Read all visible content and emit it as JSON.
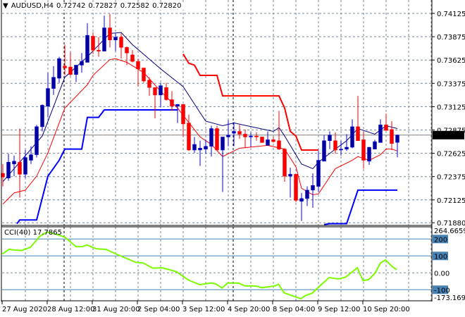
{
  "header": {
    "arrow_icon": "triangle-down-icon",
    "symbol": "AUDUSD,H4",
    "open": "0.72742",
    "high": "0.72827",
    "low": "0.72582",
    "close": "0.72820"
  },
  "price_axis": {
    "labels": [
      "0.74125",
      "0.73875",
      "0.73625",
      "0.73375",
      "0.73125",
      "0.72875",
      "0.72625",
      "0.72375",
      "0.72125",
      "0.71880"
    ],
    "current_price": "0.72820"
  },
  "time_axis": {
    "labels": [
      "27 Aug 2020",
      "28 Aug 12:00",
      "31 Aug 20:00",
      "2 Sep 04:00",
      "3 Sep 12:00",
      "4 Sep 20:00",
      "8 Sep 04:00",
      "9 Sep 12:00",
      "10 Sep 20:00"
    ]
  },
  "cci": {
    "name": "CCI(40)",
    "value": "17.7865",
    "axis_max": "264.6659",
    "axis_min": "-173.1699",
    "levels": [
      "200",
      "100",
      "0.00",
      "-100"
    ]
  },
  "colors": {
    "bull": "#0000a0",
    "bear": "#ff0000",
    "upper_band": "#000080",
    "lower_band": "#ff0000",
    "stop_upper": "#ff0000",
    "stop_lower": "#0000ff",
    "cci_line": "#7cfc00",
    "level": "#4682b4"
  },
  "chart_data": {
    "type": "candlestick",
    "title": "AUDUSD,H4",
    "ylim": [
      0.7188,
      0.74125
    ],
    "candles_ohlc": [
      [
        0.7241,
        0.7251,
        0.7227,
        0.7237
      ],
      [
        0.7236,
        0.7262,
        0.7233,
        0.7253
      ],
      [
        0.7251,
        0.726,
        0.7238,
        0.7254
      ],
      [
        0.7253,
        0.7289,
        0.7215,
        0.724
      ],
      [
        0.724,
        0.7266,
        0.7236,
        0.7258
      ],
      [
        0.7255,
        0.727,
        0.7251,
        0.7261
      ],
      [
        0.7261,
        0.7293,
        0.7258,
        0.7291
      ],
      [
        0.7291,
        0.7315,
        0.7286,
        0.7314
      ],
      [
        0.7313,
        0.7349,
        0.7301,
        0.7332
      ],
      [
        0.7332,
        0.7356,
        0.7325,
        0.7344
      ],
      [
        0.7343,
        0.7366,
        0.7338,
        0.7364
      ],
      [
        0.7356,
        0.7379,
        0.7346,
        0.7354
      ],
      [
        0.7355,
        0.7371,
        0.7345,
        0.7347
      ],
      [
        0.7347,
        0.7357,
        0.7339,
        0.7357
      ],
      [
        0.7357,
        0.737,
        0.7349,
        0.7361
      ],
      [
        0.736,
        0.7402,
        0.736,
        0.7389
      ],
      [
        0.7388,
        0.7392,
        0.7369,
        0.7373
      ],
      [
        0.7373,
        0.7387,
        0.7366,
        0.7372
      ],
      [
        0.7372,
        0.741,
        0.7372,
        0.7397
      ],
      [
        0.7397,
        0.7412,
        0.7376,
        0.7384
      ],
      [
        0.7384,
        0.7391,
        0.7372,
        0.7387
      ],
      [
        0.7387,
        0.7391,
        0.7364,
        0.7376
      ],
      [
        0.7376,
        0.7377,
        0.7357,
        0.737
      ],
      [
        0.7368,
        0.7373,
        0.736,
        0.7361
      ],
      [
        0.7361,
        0.7364,
        0.7334,
        0.7353
      ],
      [
        0.7354,
        0.7354,
        0.7338,
        0.734
      ],
      [
        0.7341,
        0.7344,
        0.7324,
        0.7333
      ],
      [
        0.7333,
        0.7333,
        0.73,
        0.7325
      ],
      [
        0.7325,
        0.7338,
        0.7312,
        0.7335
      ],
      [
        0.7333,
        0.7338,
        0.7319,
        0.732
      ],
      [
        0.732,
        0.7329,
        0.7308,
        0.7313
      ],
      [
        0.7313,
        0.7315,
        0.7295,
        0.7315
      ],
      [
        0.7315,
        0.7315,
        0.728,
        0.7294
      ],
      [
        0.7295,
        0.7304,
        0.7265,
        0.7266
      ],
      [
        0.7266,
        0.728,
        0.7263,
        0.7272
      ],
      [
        0.7266,
        0.7276,
        0.7249,
        0.7268
      ],
      [
        0.7267,
        0.7277,
        0.7262,
        0.727
      ],
      [
        0.727,
        0.7292,
        0.7259,
        0.7289
      ],
      [
        0.7289,
        0.7292,
        0.7265,
        0.7266
      ],
      [
        0.7266,
        0.728,
        0.7221,
        0.728
      ],
      [
        0.728,
        0.7298,
        0.727,
        0.7282
      ],
      [
        0.7284,
        0.7296,
        0.727,
        0.7286
      ],
      [
        0.7286,
        0.7293,
        0.7278,
        0.7283
      ],
      [
        0.7283,
        0.7288,
        0.7268,
        0.728
      ],
      [
        0.728,
        0.7285,
        0.7269,
        0.7281
      ],
      [
        0.7281,
        0.7285,
        0.7276,
        0.728
      ],
      [
        0.728,
        0.728,
        0.7274,
        0.7274
      ],
      [
        0.7271,
        0.7286,
        0.7271,
        0.7277
      ],
      [
        0.7277,
        0.728,
        0.7274,
        0.7275
      ],
      [
        0.7276,
        0.7308,
        0.7266,
        0.7267
      ],
      [
        0.7267,
        0.7268,
        0.7232,
        0.7238
      ],
      [
        0.7238,
        0.7247,
        0.7215,
        0.724
      ],
      [
        0.724,
        0.724,
        0.721,
        0.7212
      ],
      [
        0.7211,
        0.722,
        0.719,
        0.7214
      ],
      [
        0.7214,
        0.7227,
        0.7206,
        0.7223
      ],
      [
        0.7223,
        0.7241,
        0.7204,
        0.7228
      ],
      [
        0.7227,
        0.7265,
        0.7221,
        0.7255
      ],
      [
        0.7254,
        0.7282,
        0.7254,
        0.7276
      ],
      [
        0.7276,
        0.7286,
        0.7267,
        0.7282
      ],
      [
        0.7276,
        0.7285,
        0.7262,
        0.7266
      ],
      [
        0.7266,
        0.7276,
        0.726,
        0.7267
      ],
      [
        0.7267,
        0.7283,
        0.7265,
        0.7269
      ],
      [
        0.7269,
        0.7299,
        0.7268,
        0.7291
      ],
      [
        0.7291,
        0.7324,
        0.7276,
        0.7276
      ],
      [
        0.7277,
        0.7286,
        0.7246,
        0.7255
      ],
      [
        0.7254,
        0.7269,
        0.725,
        0.7269
      ],
      [
        0.7267,
        0.7277,
        0.7267,
        0.7275
      ],
      [
        0.7274,
        0.7299,
        0.7274,
        0.7293
      ],
      [
        0.7293,
        0.7305,
        0.7287,
        0.7287
      ],
      [
        0.7288,
        0.7297,
        0.7266,
        0.7273
      ],
      [
        0.72742,
        0.72827,
        0.72582,
        0.7282
      ]
    ],
    "upper_band": [
      [
        0,
        0.7232
      ],
      [
        4,
        0.726
      ],
      [
        7,
        0.7281
      ],
      [
        11,
        0.7344
      ],
      [
        15,
        0.7366
      ],
      [
        19,
        0.7391
      ],
      [
        21,
        0.7392
      ],
      [
        23,
        0.7379
      ],
      [
        28,
        0.7353
      ],
      [
        32,
        0.7334
      ],
      [
        35,
        0.7306
      ],
      [
        36,
        0.7297
      ],
      [
        39,
        0.7292
      ],
      [
        41,
        0.7295
      ],
      [
        48,
        0.7286
      ],
      [
        49,
        0.729
      ],
      [
        50,
        0.7281
      ],
      [
        53,
        0.7251
      ],
      [
        55,
        0.7246
      ],
      [
        56,
        0.7253
      ],
      [
        59,
        0.7267
      ],
      [
        61,
        0.7276
      ],
      [
        63,
        0.7289
      ],
      [
        65,
        0.7285
      ],
      [
        66,
        0.7283
      ],
      [
        68,
        0.7292
      ],
      [
        70,
        0.7289
      ]
    ],
    "lower_band": [
      [
        0,
        0.7208
      ],
      [
        2,
        0.722
      ],
      [
        4,
        0.7223
      ],
      [
        6,
        0.7238
      ],
      [
        8,
        0.7263
      ],
      [
        11,
        0.7311
      ],
      [
        15,
        0.7336
      ],
      [
        16,
        0.7346
      ],
      [
        19,
        0.7363
      ],
      [
        20,
        0.7364
      ],
      [
        22,
        0.736
      ],
      [
        25,
        0.7349
      ],
      [
        28,
        0.7329
      ],
      [
        31,
        0.7311
      ],
      [
        35,
        0.728
      ],
      [
        37,
        0.7272
      ],
      [
        39,
        0.7259
      ],
      [
        42,
        0.7268
      ],
      [
        47,
        0.7271
      ],
      [
        50,
        0.7267
      ],
      [
        52,
        0.7248
      ],
      [
        53,
        0.7225
      ],
      [
        55,
        0.7218
      ],
      [
        56,
        0.7219
      ],
      [
        59,
        0.7246
      ],
      [
        62,
        0.7255
      ],
      [
        63,
        0.7259
      ],
      [
        65,
        0.7255
      ],
      [
        67,
        0.7261
      ],
      [
        68,
        0.7267
      ],
      [
        69,
        0.7267
      ],
      [
        70,
        0.7265
      ]
    ],
    "stop_upper": [
      [
        32,
        0.7369
      ],
      [
        33,
        0.7359
      ],
      [
        34,
        0.7357
      ],
      [
        35,
        0.7346
      ],
      [
        38,
        0.7346
      ],
      [
        39,
        0.7324
      ],
      [
        49,
        0.7324
      ],
      [
        50,
        0.7311
      ],
      [
        51,
        0.7286
      ],
      [
        52,
        0.7281
      ],
      [
        53,
        0.7266
      ],
      [
        56,
        0.7266
      ]
    ],
    "stop_lower_segments": [
      [
        [
          2.5,
          0.7187
        ],
        [
          3,
          0.7191
        ],
        [
          6,
          0.7191
        ],
        [
          8,
          0.7238
        ],
        [
          10,
          0.7255
        ],
        [
          11,
          0.7267
        ],
        [
          14,
          0.7267
        ],
        [
          15,
          0.7301
        ],
        [
          17,
          0.7301
        ],
        [
          18,
          0.7309
        ],
        [
          31,
          0.7309
        ]
      ],
      [
        [
          57,
          0.7186
        ],
        [
          58,
          0.7187
        ],
        [
          61,
          0.7187
        ],
        [
          63,
          0.7223
        ],
        [
          70,
          0.7223
        ]
      ]
    ],
    "cci": {
      "ylim": [
        -173.1699,
        264.6659
      ],
      "levels": [
        200,
        100,
        0,
        -100
      ],
      "points": [
        [
          -0.1,
          111
        ],
        [
          1.1,
          139
        ],
        [
          2,
          135
        ],
        [
          3.3,
          132
        ],
        [
          4.9,
          151
        ],
        [
          6.6,
          218
        ],
        [
          7.9,
          242
        ],
        [
          9.5,
          228
        ],
        [
          11,
          211
        ],
        [
          13,
          155
        ],
        [
          14.1,
          155
        ],
        [
          14.9,
          165
        ],
        [
          16.6,
          142
        ],
        [
          18.3,
          139
        ],
        [
          20.4,
          107
        ],
        [
          23.6,
          62
        ],
        [
          24.9,
          58
        ],
        [
          26.6,
          28
        ],
        [
          28.3,
          30
        ],
        [
          30.8,
          7
        ],
        [
          32.9,
          -42
        ],
        [
          34.9,
          -70
        ],
        [
          37,
          -60
        ],
        [
          37.9,
          -67
        ],
        [
          38.9,
          -90
        ],
        [
          39.9,
          -60
        ],
        [
          41.8,
          -60
        ],
        [
          42.9,
          -77
        ],
        [
          44.9,
          -78
        ],
        [
          46,
          -88
        ],
        [
          48.3,
          -77
        ],
        [
          48.9,
          -67
        ],
        [
          49.9,
          -118
        ],
        [
          51.1,
          -133
        ],
        [
          52.9,
          -153
        ],
        [
          53.6,
          -136
        ],
        [
          54.9,
          -120
        ],
        [
          56.6,
          -67
        ],
        [
          57.9,
          -28
        ],
        [
          59.5,
          -36
        ],
        [
          60.8,
          -26
        ],
        [
          62.9,
          30
        ],
        [
          63.9,
          -46
        ],
        [
          64.9,
          -40
        ],
        [
          66,
          -4
        ],
        [
          67,
          58
        ],
        [
          67.9,
          76
        ],
        [
          69.1,
          37
        ],
        [
          69.9,
          18
        ]
      ]
    }
  }
}
